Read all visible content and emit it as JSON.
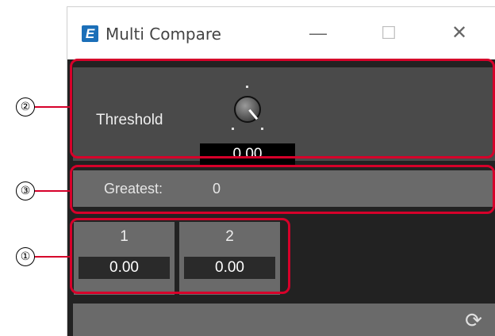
{
  "window": {
    "title": "Multi Compare",
    "app_icon_letter": "E",
    "minimize_glyph": "—",
    "maximize_glyph": "☐",
    "close_glyph": "✕"
  },
  "threshold": {
    "label": "Threshold",
    "value": "0.00"
  },
  "greatest": {
    "label": "Greatest:",
    "value": "0"
  },
  "channels": [
    {
      "number": "1",
      "value": "0.00"
    },
    {
      "number": "2",
      "value": "0.00"
    }
  ],
  "bottom": {
    "refresh_glyph": "⟳"
  },
  "callouts": [
    {
      "number": "②"
    },
    {
      "number": "③"
    },
    {
      "number": "①"
    }
  ],
  "colors": {
    "accent_red": "#d6002a",
    "app_blue": "#1b6fb8"
  }
}
